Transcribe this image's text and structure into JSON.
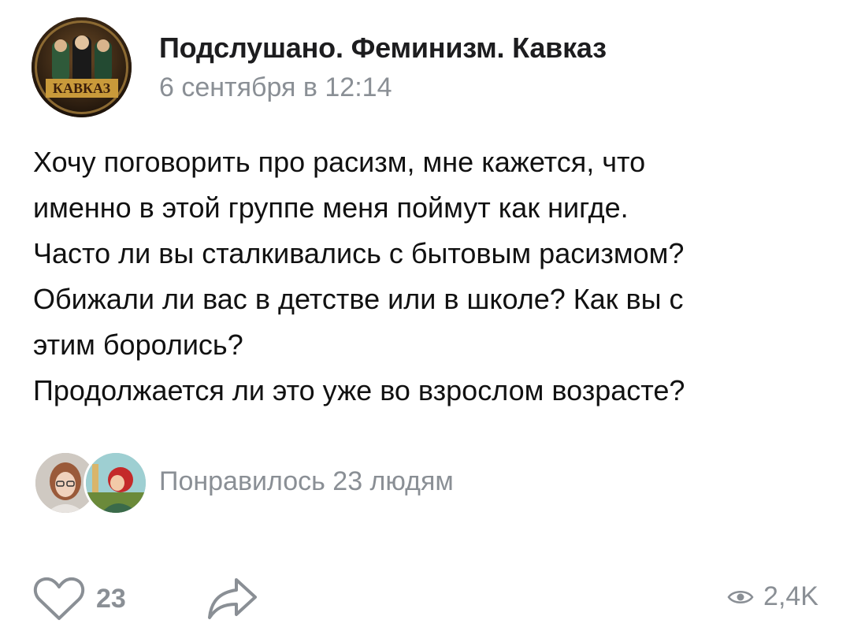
{
  "header": {
    "group_name": "Подслушано. Феминизм. Кавказ",
    "date": "6 сентября в 12:14",
    "avatar_text": "КАВКАЗ"
  },
  "post": {
    "lines": [
      "Хочу поговорить про расизм, мне кажется, что",
      "именно в этой группе меня поймут как нигде.",
      "Часто ли вы сталкивались с бытовым расизмом?",
      "Обижали ли вас в детстве или в школе? Как вы с",
      "этим боролись?",
      "Продолжается ли это уже во взрослом возрасте?"
    ]
  },
  "likes": {
    "text": "Понравилось 23 людям"
  },
  "actions": {
    "like_count": "23",
    "views_count": "2,4K",
    "like_icon": "heart-outline-icon",
    "share_icon": "share-arrow-icon",
    "views_icon": "eye-icon"
  },
  "colors": {
    "text": "#111111",
    "muted": "#8a8f95",
    "background": "#ffffff"
  }
}
